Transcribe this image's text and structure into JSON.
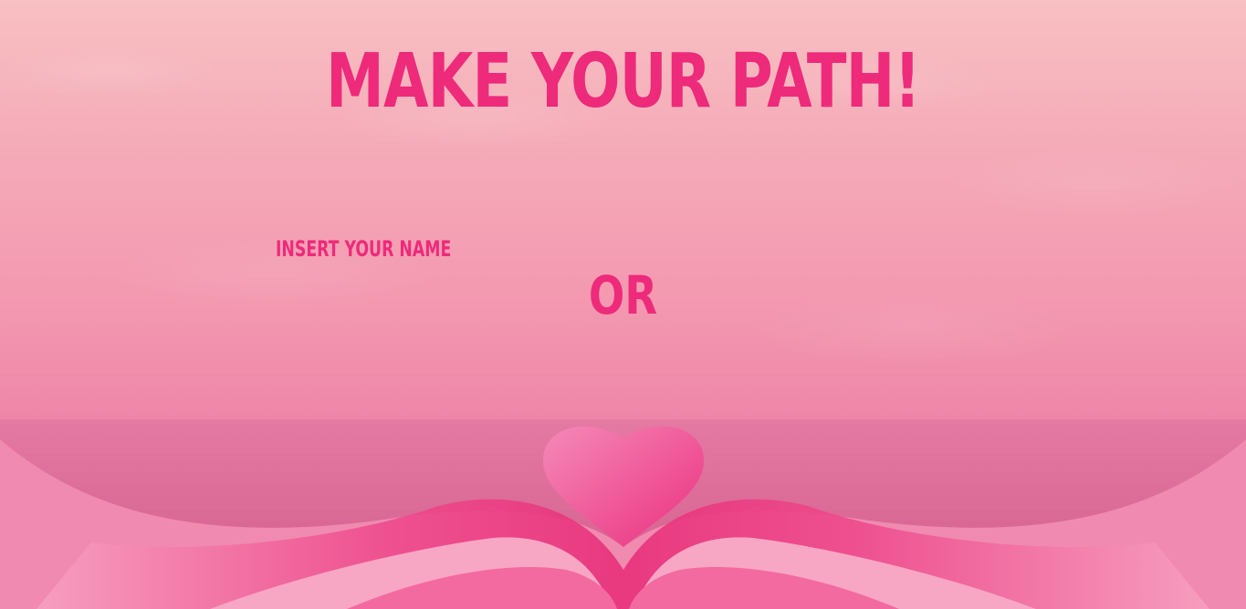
{
  "page": {
    "title": "MAKE YOUR PATH!",
    "name_prompt": "INSERT YOUR NAME",
    "separator": "OR"
  },
  "icons": {
    "heart": "heart-icon"
  },
  "colors": {
    "accent": "#ee2a7b",
    "sky_top": "#f8c0c2",
    "sky_bottom": "#e8739f",
    "heart": "#f05a99"
  }
}
